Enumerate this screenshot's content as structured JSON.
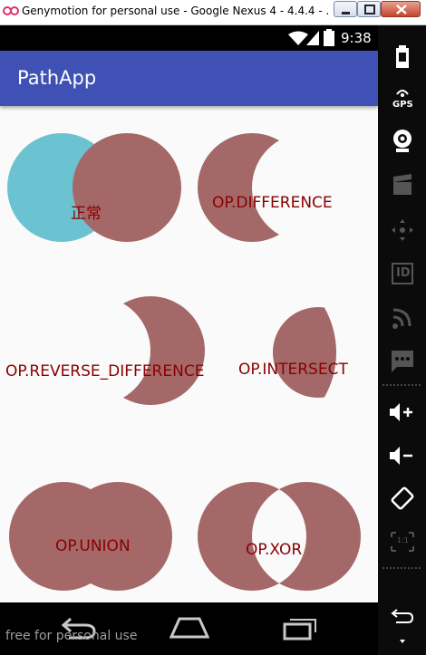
{
  "window": {
    "title": "Genymotion for personal use - Google Nexus 4 - 4.4.4 - ...",
    "minimize_icon": "minimize-icon",
    "maximize_icon": "maximize-icon",
    "close_icon": "close-icon"
  },
  "status_bar": {
    "time": "9:38",
    "icons": [
      "wifi-icon",
      "signal-icon",
      "battery-icon"
    ]
  },
  "app_bar": {
    "title": "PathApp",
    "color": "#3f51b5"
  },
  "demos": [
    {
      "label": "正常",
      "op": "normal"
    },
    {
      "label": "OP.DIFFERENCE",
      "op": "difference"
    },
    {
      "label": "OP.REVERSE_DIFFERENCE",
      "op": "reverse_difference"
    },
    {
      "label": "OP.INTERSECT",
      "op": "intersect"
    },
    {
      "label": "OP.UNION",
      "op": "union"
    },
    {
      "label": "OP.XOR",
      "op": "xor"
    }
  ],
  "colors": {
    "fill_primary": "#a46868",
    "fill_secondary": "#6bc2d0",
    "label_text": "#8b0000",
    "content_bg": "#fafafa"
  },
  "nav_bar": {
    "icons": [
      "back-icon",
      "home-icon",
      "recent-apps-icon"
    ]
  },
  "watermark": "free for personal use",
  "sidebar": {
    "items": [
      "battery-icon",
      "gps-icon",
      "webcam-icon",
      "clapperboard-icon",
      "dpad-icon",
      "id-icon",
      "rss-icon",
      "sms-icon",
      "volume-up-icon",
      "volume-down-icon",
      "rotate-icon",
      "scale-icon",
      "back-icon",
      "menu-icon"
    ],
    "gps_label": "GPS",
    "id_label": "ID",
    "scale_label": "1:1"
  }
}
